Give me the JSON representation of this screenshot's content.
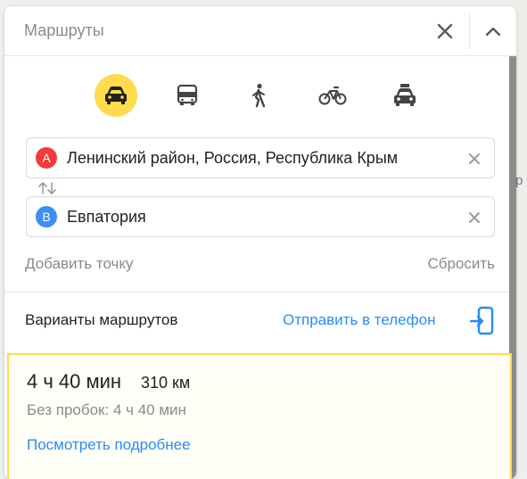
{
  "map": {
    "edge_text": "р"
  },
  "header": {
    "title": "Маршруты",
    "close_icon": "close-icon",
    "collapse_icon": "chevron-up-icon"
  },
  "modes": [
    {
      "name": "car",
      "icon": "car-icon",
      "active": true
    },
    {
      "name": "transit",
      "icon": "bus-icon",
      "active": false
    },
    {
      "name": "walk",
      "icon": "walk-icon",
      "active": false
    },
    {
      "name": "bike",
      "icon": "bike-icon",
      "active": false
    },
    {
      "name": "taxi",
      "icon": "taxi-icon",
      "active": false
    }
  ],
  "from": {
    "badge": "A",
    "value": "Ленинский район, Россия, Республика Крым",
    "badge_color": "#f33a3a"
  },
  "to": {
    "badge": "B",
    "value": "Евпатория",
    "badge_color": "#3d8ef0"
  },
  "actions": {
    "add_point": "Добавить точку",
    "reset": "Сбросить"
  },
  "variants": {
    "title": "Варианты маршрутов",
    "send_to_phone": "Отправить в телефон"
  },
  "route": {
    "time": "4 ч 40 мин",
    "distance": "310 км",
    "no_traffic": "Без пробок: 4 ч 40 мин",
    "details_link": "Посмотреть подробнее"
  },
  "colors": {
    "accent": "#ffdb4d",
    "link": "#2a8bf2"
  }
}
